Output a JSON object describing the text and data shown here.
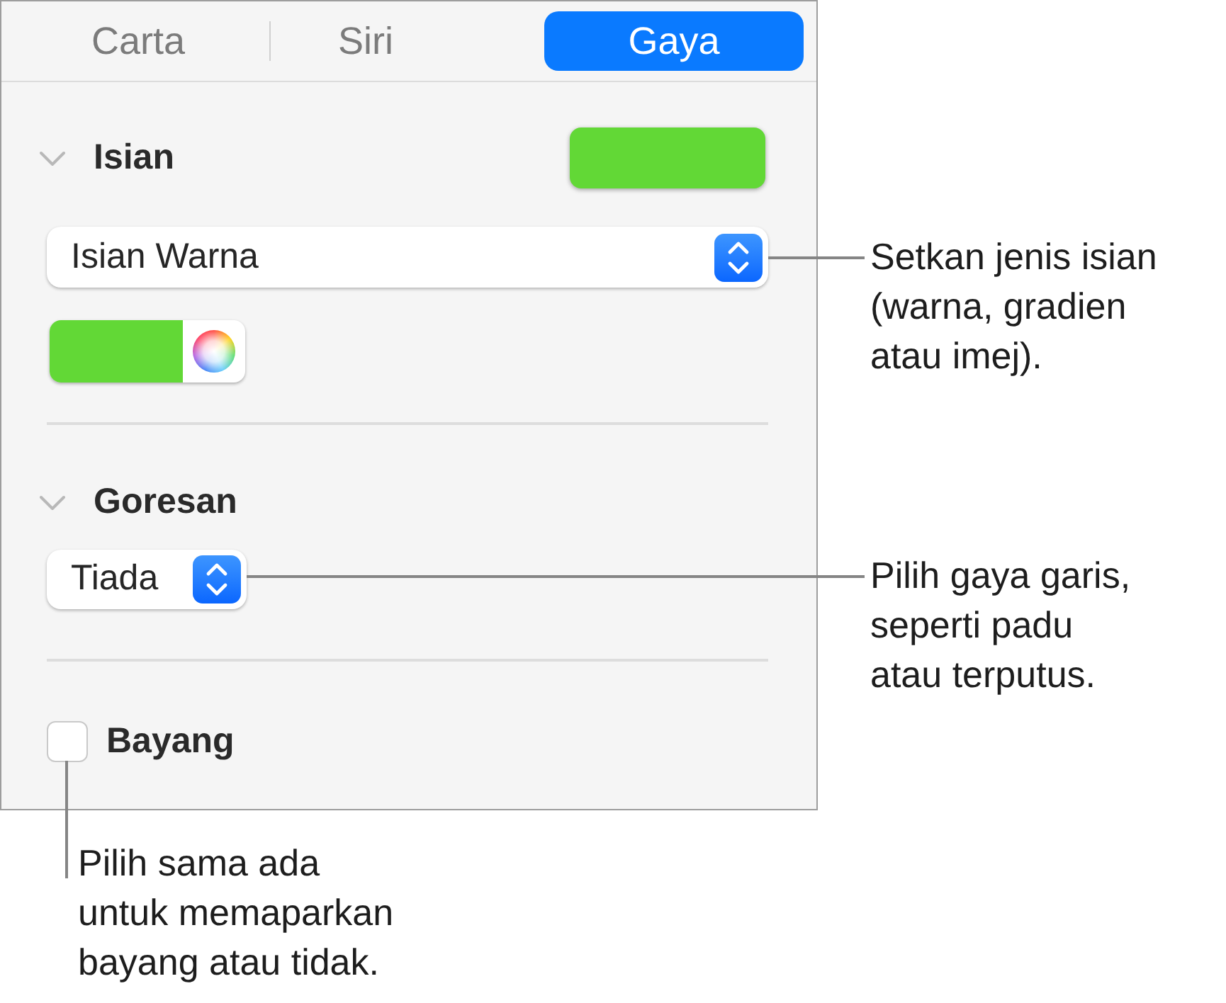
{
  "tabs": [
    {
      "label": "Carta",
      "selected": false
    },
    {
      "label": "Siri",
      "selected": false
    },
    {
      "label": "Gaya",
      "selected": true
    }
  ],
  "sections": [
    {
      "kind": "fill",
      "title": "Isian",
      "expanded": true,
      "color": "#62d836",
      "popup": "Isian Warna"
    },
    {
      "kind": "stroke",
      "title": "Goresan",
      "expanded": true,
      "popup": "Tiada"
    },
    {
      "kind": "checkbox",
      "label": "Bayang",
      "checked": false
    }
  ],
  "callouts": [
    {
      "text": "Setkan jenis isian\n(warna, gradien\natau imej)."
    },
    {
      "text": "Pilih gaya garis,\nseperti padu\natau terputus."
    },
    {
      "text": "Pilih sama ada\nuntuk memaparkan\nbayang atau tidak."
    }
  ]
}
